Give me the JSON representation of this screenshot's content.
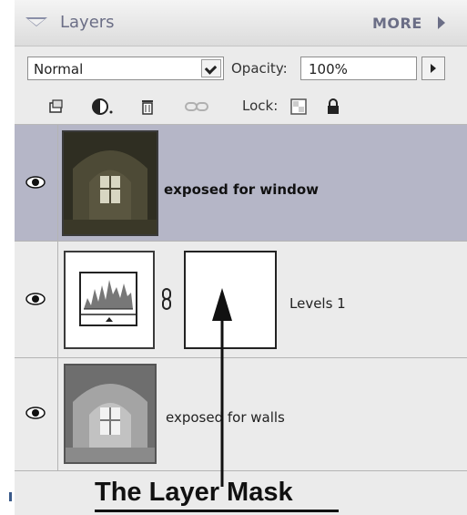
{
  "panel": {
    "title": "Layers",
    "more_label": "MORE",
    "blend_mode": "Normal",
    "opacity_label": "Opacity:",
    "opacity_value": "100%",
    "lock_label": "Lock:"
  },
  "toolbar_icons": [
    "new-layer-icon",
    "adjustment-layer-icon",
    "trash-icon",
    "link-icon",
    "lock-transparency-icon",
    "lock-all-icon"
  ],
  "layers": [
    {
      "name": "exposed for window",
      "selected": true,
      "visible": true,
      "thumbnail": "interior-dark-window-thumbnail"
    },
    {
      "name": "Levels 1",
      "selected": false,
      "visible": true,
      "thumbnail": "levels-histogram-icon",
      "has_mask": true
    },
    {
      "name": "exposed for walls",
      "selected": false,
      "visible": true,
      "thumbnail": "interior-bright-walls-thumbnail"
    }
  ],
  "annotation": {
    "text": "The Layer Mask"
  },
  "colors": {
    "selected_row": "#b5b6c7",
    "panel_bg": "#ebebeb",
    "header_text": "#6b6e86"
  }
}
